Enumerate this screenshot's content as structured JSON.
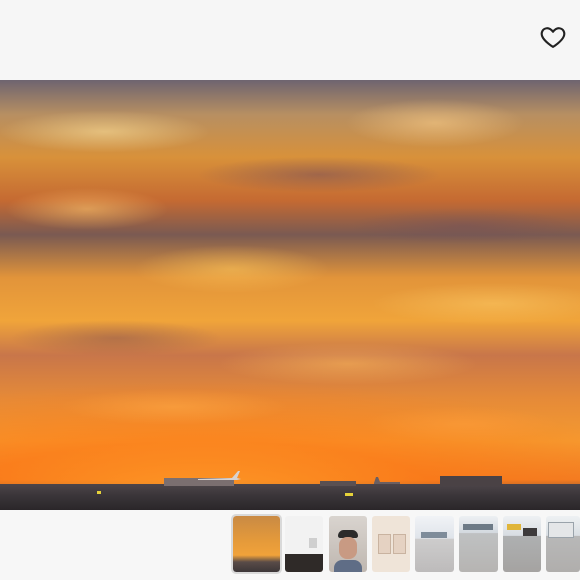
{
  "header": {
    "favorite_icon": "heart-outline-icon"
  },
  "main_photo": {
    "subject": "sunset-sky-over-airport"
  },
  "thumbnails": [
    {
      "id": "thumb-1",
      "kind": "sunset",
      "selected": true
    },
    {
      "id": "thumb-2",
      "kind": "dark-room",
      "selected": false
    },
    {
      "id": "thumb-3",
      "kind": "person-cap",
      "selected": false
    },
    {
      "id": "thumb-4",
      "kind": "document-panel",
      "selected": false
    },
    {
      "id": "thumb-5",
      "kind": "tarmac-1",
      "selected": false
    },
    {
      "id": "thumb-6",
      "kind": "tarmac-2",
      "selected": false
    },
    {
      "id": "thumb-7",
      "kind": "tarmac-3",
      "selected": false
    },
    {
      "id": "thumb-8",
      "kind": "tarmac-4",
      "selected": false
    }
  ]
}
